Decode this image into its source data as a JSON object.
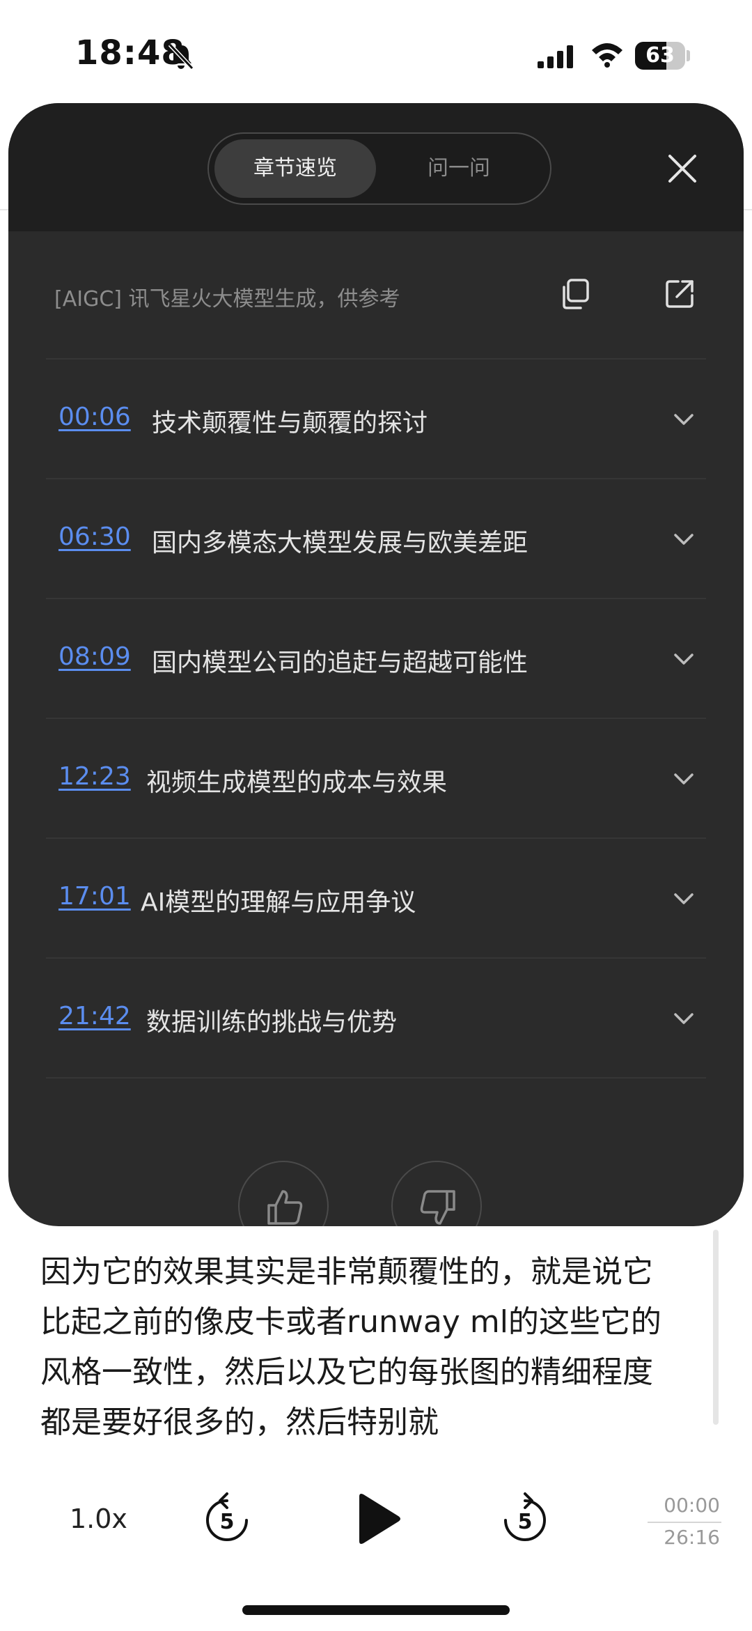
{
  "status_bar": {
    "time": "18:48",
    "battery": "63",
    "battery_level": 0.63
  },
  "sheet": {
    "tabs": [
      {
        "label": "章节速览",
        "active": true
      },
      {
        "label": "问一问",
        "active": false
      }
    ],
    "aigc_note": "[AIGC] 讯飞星火大模型生成，供参考",
    "chapters": [
      {
        "time": "00:06",
        "title": "技术颠覆性与颠覆的探讨"
      },
      {
        "time": "06:30",
        "title": "国内多模态大模型发展与欧美差距"
      },
      {
        "time": "08:09",
        "title": "国内模型公司的追赶与超越可能性"
      },
      {
        "time": "12:23",
        "title": "视频生成模型的成本与效果"
      },
      {
        "time": "17:01",
        "title": "AI模型的理解与应用争议"
      },
      {
        "time": "21:42",
        "title": "数据训练的挑战与优势"
      }
    ]
  },
  "transcript": {
    "text": "因为它的效果其实是非常颠覆性的，就是说它比起之前的像皮卡或者runway ml的这些它的风格一致性，然后以及它的每张图的精细程度都是要好很多的，然后特别就"
  },
  "player": {
    "speed": "1.0x",
    "rewind_seconds": "5",
    "forward_seconds": "5",
    "current_time": "00:00",
    "total_time": "26:16"
  },
  "colors": {
    "sheet_bg": "#2b2b2b",
    "timestamp_link": "#5b8def"
  }
}
